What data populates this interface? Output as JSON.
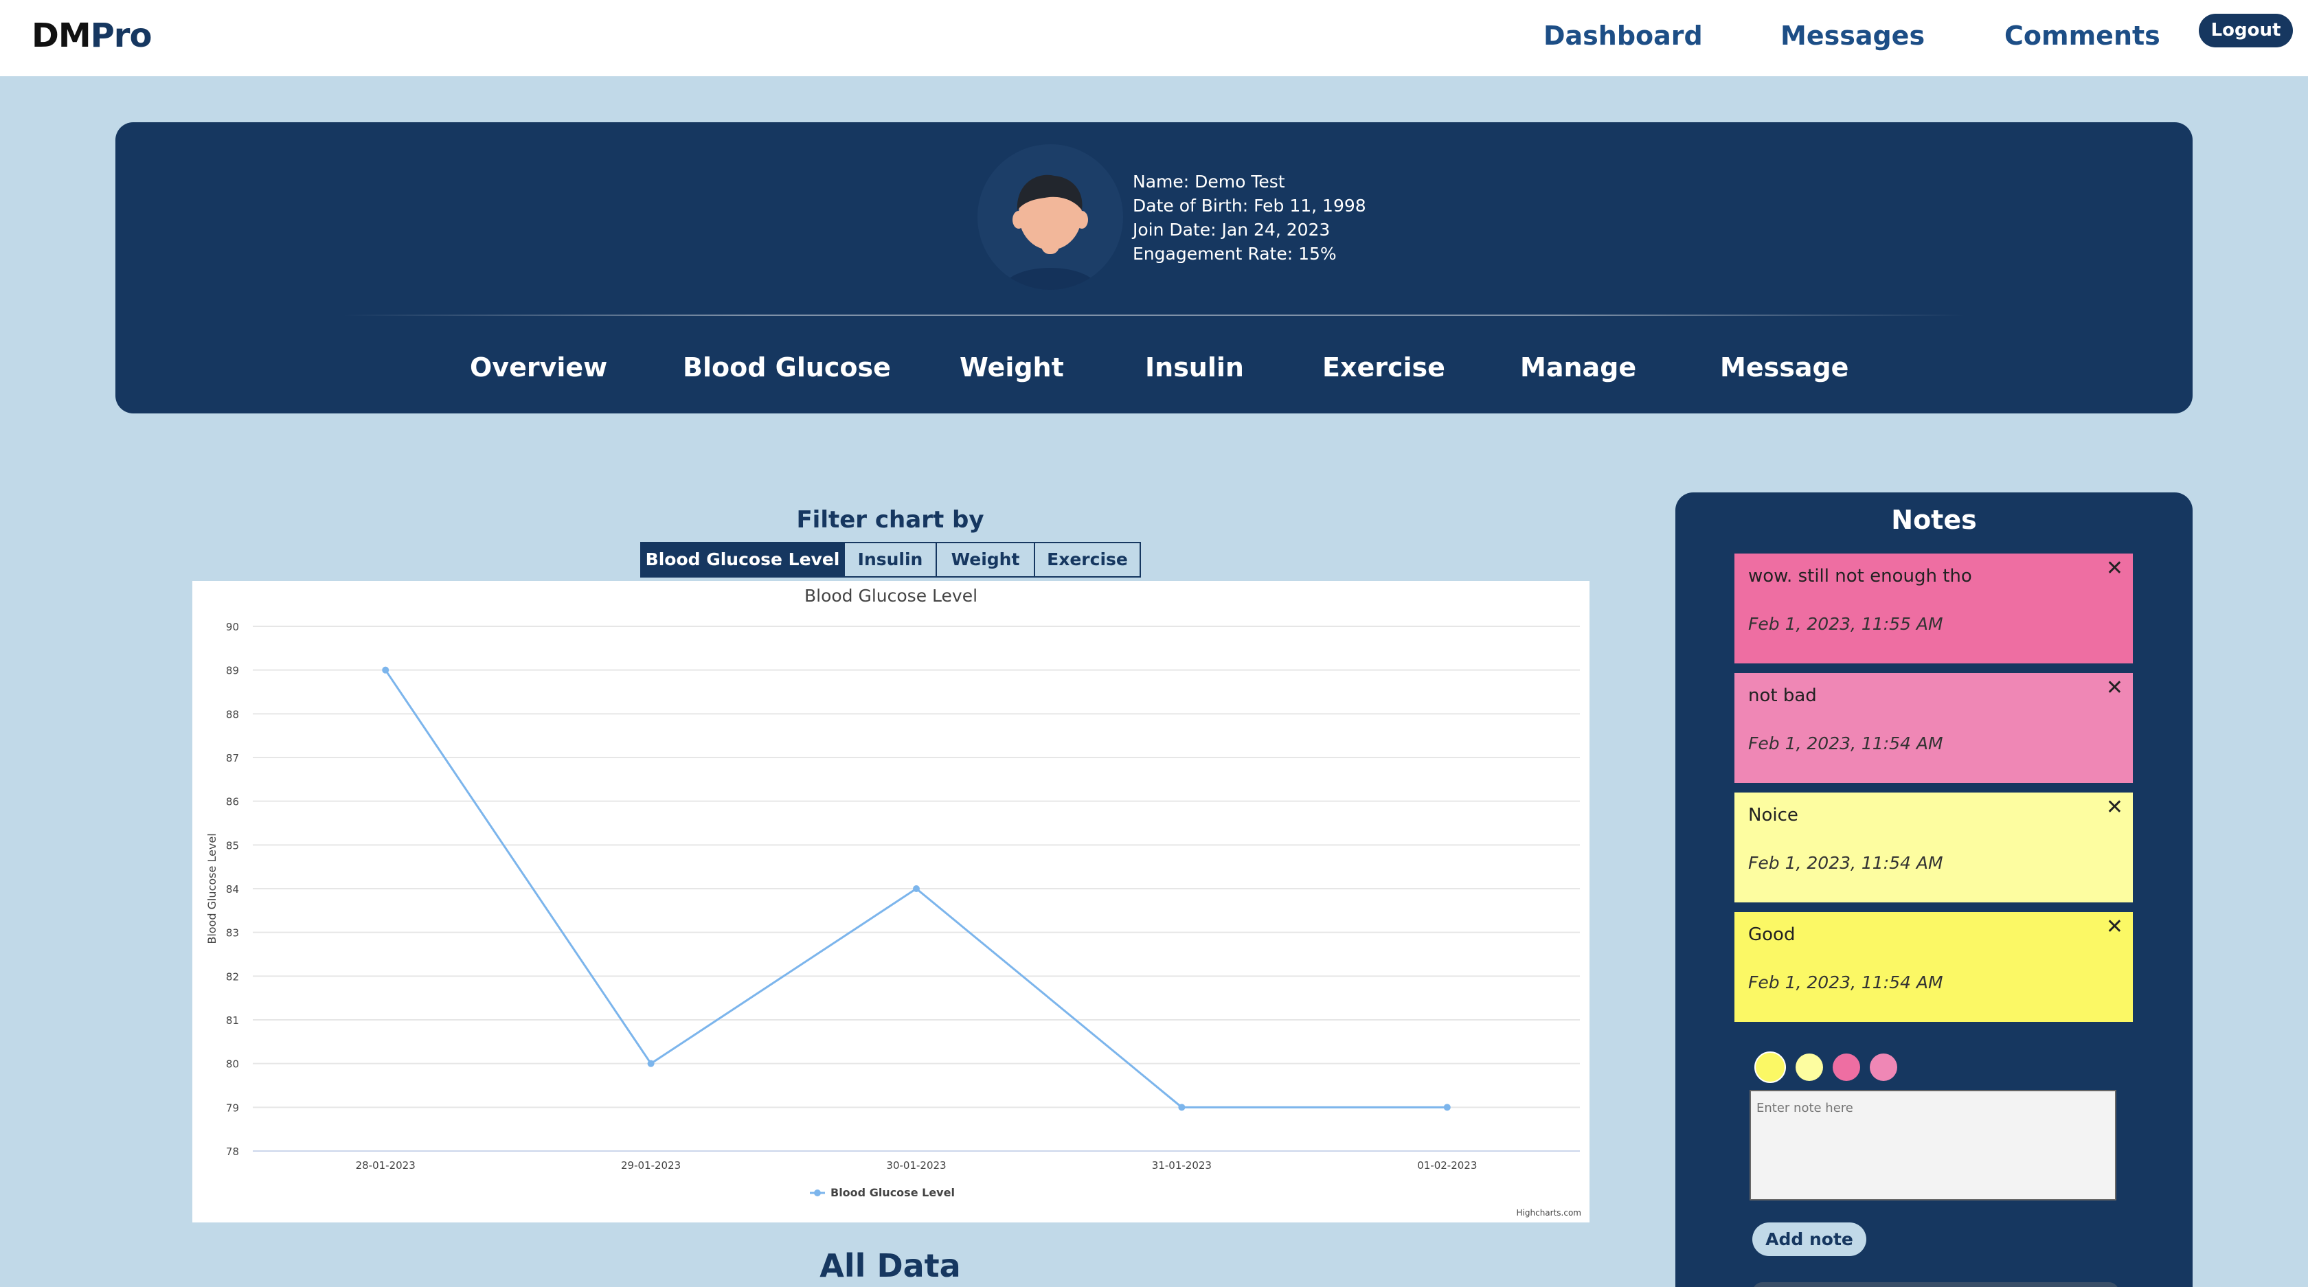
{
  "app": {
    "logo_part1": "DM",
    "logo_part2": "Pro"
  },
  "topnav": {
    "items": [
      "Dashboard",
      "Messages",
      "Comments"
    ],
    "logout_label": "Logout"
  },
  "profile": {
    "name": "Name: Demo Test",
    "dob": "Date of Birth: Feb 11, 1998",
    "join_date": "Join Date: Jan 24, 2023",
    "engagement": "Engagement Rate: 15%",
    "tabs": [
      "Overview",
      "Blood Glucose",
      "Weight",
      "Insulin",
      "Exercise",
      "Manage",
      "Message"
    ]
  },
  "filter": {
    "title": "Filter chart by",
    "buttons": [
      "Blood Glucose Level",
      "Insulin",
      "Weight",
      "Exercise"
    ],
    "active": "Blood Glucose Level"
  },
  "chart_data": {
    "type": "line",
    "title": "Blood Glucose Level",
    "ylabel": "Blood Glucose Level",
    "xlabel": "",
    "categories": [
      "28-01-2023",
      "29-01-2023",
      "30-01-2023",
      "31-01-2023",
      "01-02-2023"
    ],
    "series": [
      {
        "name": "Blood Glucose Level",
        "values": [
          89,
          80,
          84,
          79,
          79
        ]
      }
    ],
    "ylim": [
      78,
      90
    ],
    "yticks": [
      "90",
      "89",
      "88",
      "87",
      "86",
      "85",
      "84",
      "83",
      "82",
      "81",
      "80",
      "79",
      "78"
    ],
    "grid": true,
    "legend_position": "bottom",
    "credits": "Highcharts.com",
    "line_color": "#7cb5ec"
  },
  "main": {
    "all_data_title": "All Data"
  },
  "notes": {
    "title": "Notes",
    "items": [
      {
        "text": "wow. still not enough tho",
        "date": "Feb 1, 2023, 11:55 AM",
        "color": "#ee6ea2"
      },
      {
        "text": "not bad",
        "date": "Feb 1, 2023, 11:54 AM",
        "color": "#ef87b5"
      },
      {
        "text": "Noice",
        "date": "Feb 1, 2023, 11:54 AM",
        "color": "#fdfda0"
      },
      {
        "text": "Good",
        "date": "Feb 1, 2023, 11:54 AM",
        "color": "#fbf865"
      }
    ],
    "close_glyph": "✕",
    "swatches": [
      "#fbf865",
      "#fdfda0",
      "#ee6ea2",
      "#ef87b5"
    ],
    "input_placeholder": "Enter note here",
    "add_label": "Add note"
  }
}
